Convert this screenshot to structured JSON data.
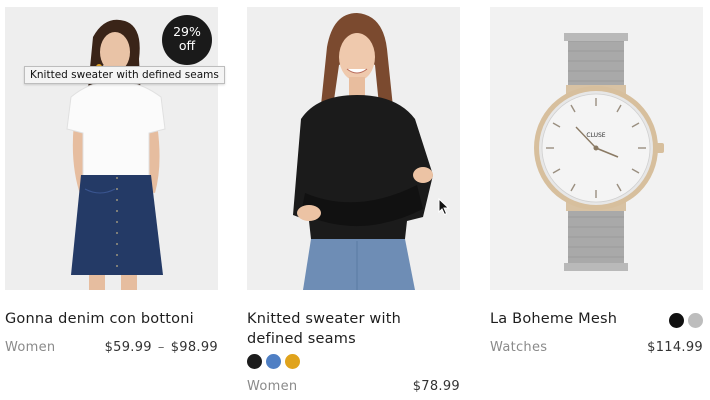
{
  "products": [
    {
      "title": "Gonna denim con bottoni",
      "category": "Women",
      "price_min": "$59.99",
      "price_sep": "–",
      "price_max": "$98.99",
      "badge_line1": "29%",
      "badge_line2": "off",
      "image_icon": "model-white-tee-denim-skirt",
      "swatches": []
    },
    {
      "title": "Knitted sweater with defined seams",
      "category": "Women",
      "price": "$78.99",
      "image_icon": "model-black-knit-sweater",
      "swatches": [
        {
          "name": "black-swatch",
          "color": "#1c1c1c"
        },
        {
          "name": "blue-pattern-swatch",
          "color": "#4f7fc4"
        },
        {
          "name": "yellow-pattern-swatch",
          "color": "#e0a31c"
        }
      ]
    },
    {
      "title": "La Boheme Mesh",
      "category": "Watches",
      "price": "$114.99",
      "image_icon": "silver-mesh-watch",
      "watch_brand": "CLUSE",
      "swatches": [
        {
          "name": "black-swatch",
          "color": "#111111"
        },
        {
          "name": "silver-swatch",
          "color": "#bdbdbd"
        }
      ]
    }
  ],
  "tooltip": "Knitted sweater with defined seams",
  "cursor_icon": "mouse-pointer-icon"
}
